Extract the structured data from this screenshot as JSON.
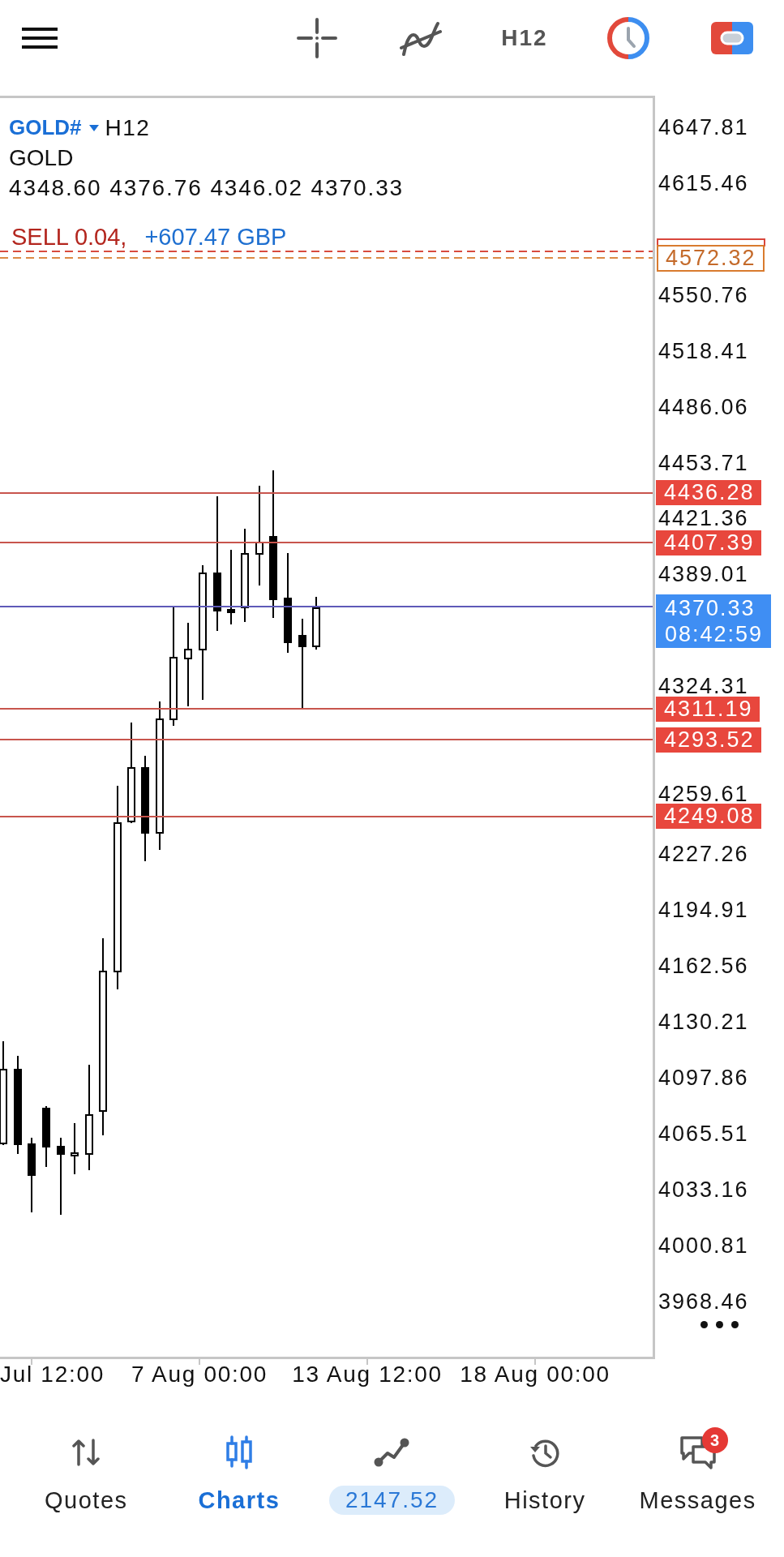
{
  "top_bar": {
    "timeframe": "H12"
  },
  "chart": {
    "symbol": "GOLD#",
    "timeframe": "H12",
    "description": "GOLD",
    "ohlc": "4348.60 4376.76 4346.02 4370.33",
    "lines": [
      {
        "kind": "stop-loss"
      },
      {
        "kind": "order",
        "price": "4572.32",
        "label": "SELL 0.04,",
        "profit": "+607.47 GBP"
      },
      {
        "kind": "level",
        "price": "4436.28"
      },
      {
        "kind": "level",
        "price": "4407.39"
      },
      {
        "kind": "bid",
        "price": "4370.33",
        "countdown": "08:42:59"
      },
      {
        "kind": "level",
        "price": "4311.19"
      },
      {
        "kind": "level",
        "price": "4293.52"
      },
      {
        "kind": "level",
        "price": "4249.08"
      }
    ],
    "price_axis": [
      "4647.81",
      "4615.46",
      "4550.76",
      "4518.41",
      "4486.06",
      "4453.71",
      "4421.36",
      "4389.01",
      "4324.31",
      "4259.61",
      "4227.26",
      "4194.91",
      "4162.56",
      "4130.21",
      "4097.86",
      "4065.51",
      "4033.16",
      "4000.81",
      "3968.46"
    ],
    "time_axis": [
      "Jul 12:00",
      "7 Aug 00:00",
      "13 Aug 12:00",
      "18 Aug 00:00"
    ]
  },
  "bottom_nav": [
    {
      "kind": "tab",
      "label": "Quotes",
      "selected": false
    },
    {
      "kind": "tab",
      "label": "Charts",
      "selected": true
    },
    {
      "kind": "balance",
      "value": "2147.52",
      "selected": false
    },
    {
      "kind": "tab",
      "label": "History",
      "selected": false
    },
    {
      "kind": "tab",
      "label": "Messages",
      "selected": false,
      "badge": "3"
    }
  ]
}
